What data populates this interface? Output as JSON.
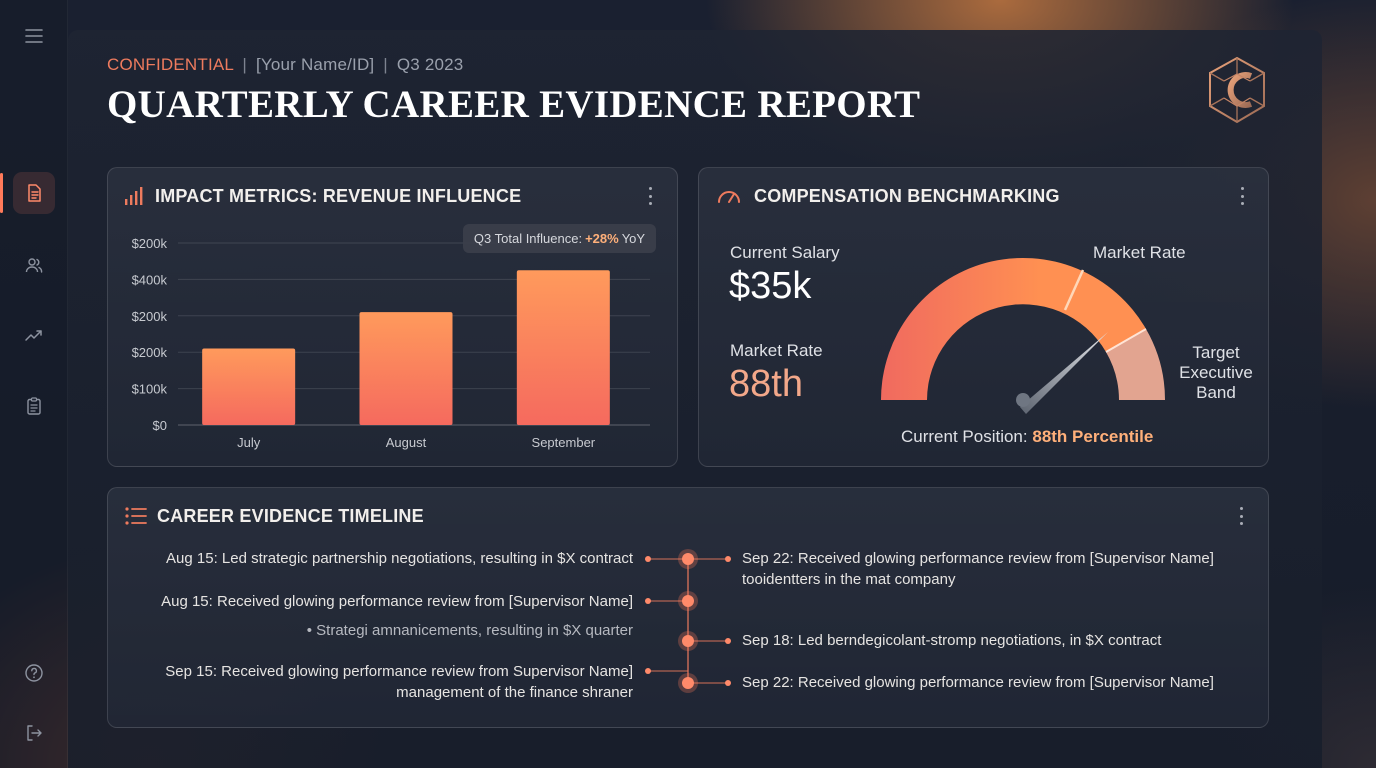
{
  "header": {
    "confidential": "CONFIDENTIAL",
    "separator": "|",
    "name_placeholder": "[Your Name/ID]",
    "quarter": "Q3 2023",
    "title": "QUARTERLY CAREER EVIDENCE REPORT"
  },
  "sidebar": {
    "items": [
      {
        "icon": "menu-icon"
      },
      {
        "icon": "document-icon",
        "active": true
      },
      {
        "icon": "users-icon"
      },
      {
        "icon": "trending-up-icon"
      },
      {
        "icon": "clipboard-icon"
      },
      {
        "icon": "help-icon"
      },
      {
        "icon": "logout-icon"
      }
    ]
  },
  "impact": {
    "title": "IMPACT METRICS: REVENUE INFLUENCE",
    "tooltip_prefix": "Q3 Total Influence:",
    "tooltip_value": "+28%",
    "tooltip_suffix": "YoY"
  },
  "chart_data": {
    "type": "bar",
    "categories": [
      "July",
      "August",
      "September"
    ],
    "y_tick_labels": [
      "$0",
      "$100k",
      "$200k",
      "$200k",
      "$400k",
      "$200k"
    ],
    "values": [
      2.1,
      3.1,
      4.25
    ],
    "value_unit_note": "values read in tick-row units (0 = $0 row, 5 = top row)",
    "ylim": [
      0,
      5
    ],
    "grid": true,
    "colors": {
      "bar_top": "#ff9a5c",
      "bar_bottom": "#f56a5e"
    }
  },
  "compensation": {
    "title": "COMPENSATION BENCHMARKING",
    "current_salary_label": "Current Salary",
    "current_salary_value": "$35k",
    "market_rate_label": "Market Rate",
    "market_rate_value": "88th",
    "gauge_market_rate_label": "Market Rate",
    "gauge_target_label": "Target Executive Band",
    "position_prefix": "Current Position:",
    "position_value": "88th Percentile",
    "gauge_level": 0.82
  },
  "timeline": {
    "title": "CAREER EVIDENCE TIMELINE",
    "left": [
      {
        "text": "Aug 15: Led strategic partnership negotiations, resulting in $X contract"
      },
      {
        "text": "Aug 15: Received glowing performance review from [Supervisor Name]"
      },
      {
        "text": "• Strategi amnanicements, resulting in $X quarter"
      },
      {
        "text": "Sep 15: Received glowing performance review from Supervisor Name]"
      },
      {
        "text": "management of the finance shraner"
      }
    ],
    "right": [
      {
        "text": "Sep 22: Received glowing performance review from [Supervisor Name]"
      },
      {
        "text": "tooidentters in the mat company"
      },
      {
        "text": "Sep 18: Led berndegicolant-stromp negotiations, in $X contract"
      },
      {
        "text": "Sep 22: Received glowing performance review from [Supervisor Name]"
      }
    ]
  },
  "colors": {
    "accent": "#ee7b5e",
    "highlight": "#ffb07a",
    "background": "#161c29"
  }
}
